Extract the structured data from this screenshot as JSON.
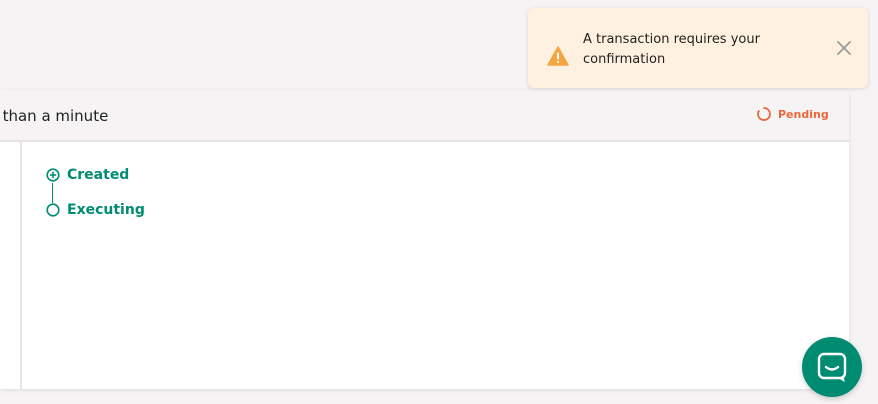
{
  "toast": {
    "message": "A transaction requires your confirmation",
    "icon": "warning-icon",
    "close_icon": "close-icon",
    "accent_color": "#f2a540"
  },
  "card": {
    "header_text": "s than a minute",
    "status": {
      "label": "Pending",
      "icon": "spinner-icon",
      "color": "#e8673c"
    },
    "steps": [
      {
        "label": "Created",
        "icon": "plus-circle-icon"
      },
      {
        "label": "Executing",
        "icon": "circle-icon"
      }
    ],
    "accent_color": "#008c73"
  },
  "chat": {
    "icon": "chat-icon",
    "color": "#008c73"
  }
}
